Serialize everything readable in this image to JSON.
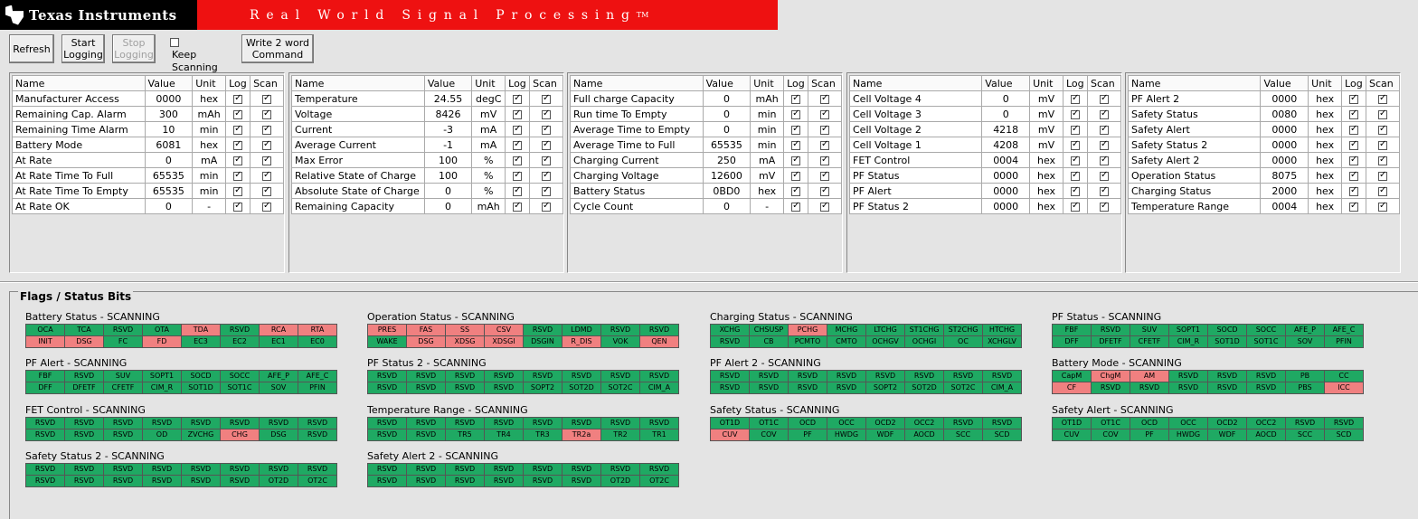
{
  "banner": {
    "brand": "Texas Instruments",
    "tagline": "Real World Signal Processing",
    "tm": "TM"
  },
  "toolbar": {
    "refresh": "Refresh",
    "start_logging": "Start Logging",
    "stop_logging": "Stop Logging",
    "keep_scanning": "Keep Scanning",
    "write_word": "Write 2 word Command"
  },
  "columns": [
    "Name",
    "Value",
    "Unit",
    "Log",
    "Scan"
  ],
  "tables": [
    [
      {
        "name": "Manufacturer Access",
        "value": "0000",
        "unit": "hex"
      },
      {
        "name": "Remaining Cap. Alarm",
        "value": "300",
        "unit": "mAh"
      },
      {
        "name": "Remaining Time Alarm",
        "value": "10",
        "unit": "min"
      },
      {
        "name": "Battery Mode",
        "value": "6081",
        "unit": "hex"
      },
      {
        "name": "At Rate",
        "value": "0",
        "unit": "mA"
      },
      {
        "name": "At Rate Time To Full",
        "value": "65535",
        "unit": "min"
      },
      {
        "name": "At Rate Time To Empty",
        "value": "65535",
        "unit": "min"
      },
      {
        "name": "At Rate OK",
        "value": "0",
        "unit": "-"
      }
    ],
    [
      {
        "name": "Temperature",
        "value": "24.55",
        "unit": "degC"
      },
      {
        "name": "Voltage",
        "value": "8426",
        "unit": "mV"
      },
      {
        "name": "Current",
        "value": "-3",
        "unit": "mA"
      },
      {
        "name": "Average Current",
        "value": "-1",
        "unit": "mA"
      },
      {
        "name": "Max Error",
        "value": "100",
        "unit": "%"
      },
      {
        "name": "Relative State of Charge",
        "value": "100",
        "unit": "%"
      },
      {
        "name": "Absolute State of Charge",
        "value": "0",
        "unit": "%"
      },
      {
        "name": "Remaining Capacity",
        "value": "0",
        "unit": "mAh"
      }
    ],
    [
      {
        "name": "Full charge Capacity",
        "value": "0",
        "unit": "mAh"
      },
      {
        "name": "Run time To Empty",
        "value": "0",
        "unit": "min"
      },
      {
        "name": "Average Time to Empty",
        "value": "0",
        "unit": "min"
      },
      {
        "name": "Average Time to Full",
        "value": "65535",
        "unit": "min"
      },
      {
        "name": "Charging Current",
        "value": "250",
        "unit": "mA"
      },
      {
        "name": "Charging Voltage",
        "value": "12600",
        "unit": "mV"
      },
      {
        "name": "Battery Status",
        "value": "0BD0",
        "unit": "hex"
      },
      {
        "name": "Cycle Count",
        "value": "0",
        "unit": "-"
      }
    ],
    [
      {
        "name": "Cell Voltage 4",
        "value": "0",
        "unit": "mV"
      },
      {
        "name": "Cell Voltage 3",
        "value": "0",
        "unit": "mV"
      },
      {
        "name": "Cell Voltage 2",
        "value": "4218",
        "unit": "mV"
      },
      {
        "name": "Cell Voltage 1",
        "value": "4208",
        "unit": "mV"
      },
      {
        "name": "FET Control",
        "value": "0004",
        "unit": "hex"
      },
      {
        "name": "PF Status",
        "value": "0000",
        "unit": "hex"
      },
      {
        "name": "PF Alert",
        "value": "0000",
        "unit": "hex"
      },
      {
        "name": "PF Status 2",
        "value": "0000",
        "unit": "hex"
      }
    ],
    [
      {
        "name": "PF Alert 2",
        "value": "0000",
        "unit": "hex"
      },
      {
        "name": "Safety Status",
        "value": "0080",
        "unit": "hex"
      },
      {
        "name": "Safety Alert",
        "value": "0000",
        "unit": "hex"
      },
      {
        "name": "Safety Status 2",
        "value": "0000",
        "unit": "hex"
      },
      {
        "name": "Safety Alert 2",
        "value": "0000",
        "unit": "hex"
      },
      {
        "name": "Operation Status",
        "value": "8075",
        "unit": "hex"
      },
      {
        "name": "Charging Status",
        "value": "2000",
        "unit": "hex"
      },
      {
        "name": "Temperature Range",
        "value": "0004",
        "unit": "hex"
      }
    ]
  ],
  "flags": {
    "title": "Flags / Status Bits",
    "groups": [
      {
        "title": "Battery Status - SCANNING",
        "rows": [
          [
            "OCA",
            "TCA",
            "RSVD",
            "OTA",
            "TDA",
            "RSVD",
            "RCA",
            "RTA"
          ],
          [
            "INIT",
            "DSG",
            "FC",
            "FD",
            "EC3",
            "EC2",
            "EC1",
            "EC0"
          ]
        ],
        "set": [
          [
            0,
            4
          ],
          [
            0,
            6
          ],
          [
            0,
            7
          ],
          [
            1,
            0
          ],
          [
            1,
            1
          ],
          [
            1,
            3
          ]
        ]
      },
      {
        "title": "Operation Status - SCANNING",
        "rows": [
          [
            "PRES",
            "FAS",
            "SS",
            "CSV",
            "RSVD",
            "LDMD",
            "RSVD",
            "RSVD"
          ],
          [
            "WAKE",
            "DSG",
            "XDSG",
            "XDSGI",
            "DSGIN",
            "R_DIS",
            "VOK",
            "QEN"
          ]
        ],
        "set": [
          [
            0,
            0
          ],
          [
            0,
            1
          ],
          [
            0,
            2
          ],
          [
            0,
            3
          ],
          [
            1,
            1
          ],
          [
            1,
            2
          ],
          [
            1,
            3
          ],
          [
            1,
            5
          ],
          [
            1,
            7
          ]
        ]
      },
      {
        "title": "Charging Status - SCANNING",
        "rows": [
          [
            "XCHG",
            "CHSUSP",
            "PCHG",
            "MCHG",
            "LTCHG",
            "ST1CHG",
            "ST2CHG",
            "HTCHG"
          ],
          [
            "RSVD",
            "CB",
            "PCMTO",
            "CMTO",
            "OCHGV",
            "OCHGI",
            "OC",
            "XCHGLV"
          ]
        ],
        "set": [
          [
            0,
            2
          ]
        ]
      },
      {
        "title": "PF Status - SCANNING",
        "rows": [
          [
            "FBF",
            "RSVD",
            "SUV",
            "SOPT1",
            "SOCD",
            "SOCC",
            "AFE_P",
            "AFE_C"
          ],
          [
            "DFF",
            "DFETF",
            "CFETF",
            "CIM_R",
            "SOT1D",
            "SOT1C",
            "SOV",
            "PFIN"
          ]
        ],
        "set": []
      },
      {
        "title": "PF Alert - SCANNING",
        "rows": [
          [
            "FBF",
            "RSVD",
            "SUV",
            "SOPT1",
            "SOCD",
            "SOCC",
            "AFE_P",
            "AFE_C"
          ],
          [
            "DFF",
            "DFETF",
            "CFETF",
            "CIM_R",
            "SOT1D",
            "SOT1C",
            "SOV",
            "PFIN"
          ]
        ],
        "set": []
      },
      {
        "title": "PF Status 2 - SCANNING",
        "rows": [
          [
            "RSVD",
            "RSVD",
            "RSVD",
            "RSVD",
            "RSVD",
            "RSVD",
            "RSVD",
            "RSVD"
          ],
          [
            "RSVD",
            "RSVD",
            "RSVD",
            "RSVD",
            "SOPT2",
            "SOT2D",
            "SOT2C",
            "CIM_A"
          ]
        ],
        "set": []
      },
      {
        "title": "PF Alert 2 - SCANNING",
        "rows": [
          [
            "RSVD",
            "RSVD",
            "RSVD",
            "RSVD",
            "RSVD",
            "RSVD",
            "RSVD",
            "RSVD"
          ],
          [
            "RSVD",
            "RSVD",
            "RSVD",
            "RSVD",
            "SOPT2",
            "SOT2D",
            "SOT2C",
            "CIM_A"
          ]
        ],
        "set": []
      },
      {
        "title": "Battery Mode - SCANNING",
        "rows": [
          [
            "CapM",
            "ChgM",
            "AM",
            "RSVD",
            "RSVD",
            "RSVD",
            "PB",
            "CC"
          ],
          [
            "CF",
            "RSVD",
            "RSVD",
            "RSVD",
            "RSVD",
            "RSVD",
            "PBS",
            "ICC"
          ]
        ],
        "set": [
          [
            0,
            1
          ],
          [
            0,
            2
          ],
          [
            1,
            0
          ],
          [
            1,
            7
          ]
        ]
      },
      {
        "title": "FET Control - SCANNING",
        "rows": [
          [
            "RSVD",
            "RSVD",
            "RSVD",
            "RSVD",
            "RSVD",
            "RSVD",
            "RSVD",
            "RSVD"
          ],
          [
            "RSVD",
            "RSVD",
            "RSVD",
            "OD",
            "ZVCHG",
            "CHG",
            "DSG",
            "RSVD"
          ]
        ],
        "set": [
          [
            1,
            5
          ]
        ]
      },
      {
        "title": "Temperature Range - SCANNING",
        "rows": [
          [
            "RSVD",
            "RSVD",
            "RSVD",
            "RSVD",
            "RSVD",
            "RSVD",
            "RSVD",
            "RSVD"
          ],
          [
            "RSVD",
            "RSVD",
            "TR5",
            "TR4",
            "TR3",
            "TR2a",
            "TR2",
            "TR1"
          ]
        ],
        "set": [
          [
            1,
            5
          ]
        ]
      },
      {
        "title": "Safety Status - SCANNING",
        "rows": [
          [
            "OT1D",
            "OT1C",
            "OCD",
            "OCC",
            "OCD2",
            "OCC2",
            "RSVD",
            "RSVD"
          ],
          [
            "CUV",
            "COV",
            "PF",
            "HWDG",
            "WDF",
            "AOCD",
            "SCC",
            "SCD"
          ]
        ],
        "set": [
          [
            1,
            0
          ]
        ]
      },
      {
        "title": "Safety Alert - SCANNING",
        "rows": [
          [
            "OT1D",
            "OT1C",
            "OCD",
            "OCC",
            "OCD2",
            "OCC2",
            "RSVD",
            "RSVD"
          ],
          [
            "CUV",
            "COV",
            "PF",
            "HWDG",
            "WDF",
            "AOCD",
            "SCC",
            "SCD"
          ]
        ],
        "set": []
      },
      {
        "title": "Safety Status 2 - SCANNING",
        "rows": [
          [
            "RSVD",
            "RSVD",
            "RSVD",
            "RSVD",
            "RSVD",
            "RSVD",
            "RSVD",
            "RSVD"
          ],
          [
            "RSVD",
            "RSVD",
            "RSVD",
            "RSVD",
            "RSVD",
            "RSVD",
            "OT2D",
            "OT2C"
          ]
        ],
        "set": []
      },
      {
        "title": "Safety Alert 2 - SCANNING",
        "rows": [
          [
            "RSVD",
            "RSVD",
            "RSVD",
            "RSVD",
            "RSVD",
            "RSVD",
            "RSVD",
            "RSVD"
          ],
          [
            "RSVD",
            "RSVD",
            "RSVD",
            "RSVD",
            "RSVD",
            "RSVD",
            "OT2D",
            "OT2C"
          ]
        ],
        "set": []
      }
    ]
  }
}
